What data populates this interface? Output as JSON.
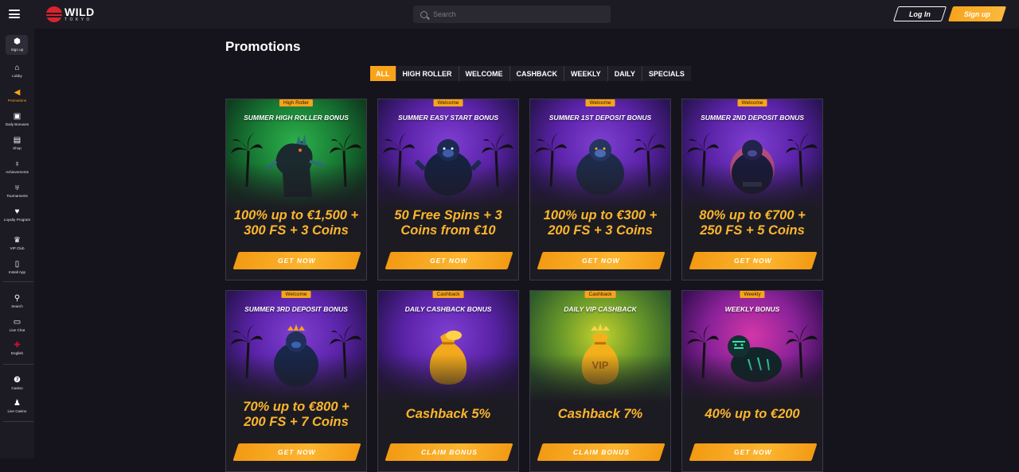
{
  "topbar": {
    "logo_main": "WILD",
    "logo_sub": "TOKYO",
    "search_placeholder": "Search",
    "login_label": "Log In",
    "signup_label": "Sign up"
  },
  "sidebar": {
    "items": [
      {
        "label": "Sign up",
        "icon": "plus-badge-icon"
      },
      {
        "label": "Lobby",
        "icon": "home-icon"
      },
      {
        "label": "Promotions",
        "icon": "megaphone-icon"
      },
      {
        "label": "Daily Bonuses",
        "icon": "gift-icon"
      },
      {
        "label": "Shop",
        "icon": "shop-icon"
      },
      {
        "label": "Achievements",
        "icon": "medal-icon"
      },
      {
        "label": "Tournaments",
        "icon": "trophy-icon"
      },
      {
        "label": "Loyalty Program",
        "icon": "heart-icon"
      },
      {
        "label": "VIP Club",
        "icon": "crown-icon"
      },
      {
        "label": "Install App",
        "icon": "phone-icon"
      },
      {
        "label": "Search",
        "icon": "search-icon"
      },
      {
        "label": "Live Chat",
        "icon": "chat-icon"
      },
      {
        "label": "English",
        "icon": "uk-flag-icon"
      },
      {
        "label": "Casino",
        "icon": "slot-icon"
      },
      {
        "label": "Live Casino",
        "icon": "dealer-icon"
      }
    ]
  },
  "page": {
    "title": "Promotions",
    "tabs": [
      "ALL",
      "HIGH ROLLER",
      "WELCOME",
      "CASHBACK",
      "WEEKLY",
      "DAILY",
      "SPECIALS"
    ],
    "active_tab": "ALL"
  },
  "promotions": [
    {
      "badge": "High Roller",
      "title": "SUMMER HIGH ROLLER BONUS",
      "offer_line1": "100% up to €1,500 +",
      "offer_line2": "300 FS + 3 Coins",
      "button": "GET NOW"
    },
    {
      "badge": "Welcome",
      "title": "SUMMER EASY START BONUS",
      "offer_line1": "50 Free Spins + 3",
      "offer_line2": "Coins from €10",
      "button": "GET NOW"
    },
    {
      "badge": "Welcome",
      "title": "SUMMER 1ST DEPOSIT BONUS",
      "offer_line1": "100% up to €300 +",
      "offer_line2": "200 FS + 3 Coins",
      "button": "GET NOW"
    },
    {
      "badge": "Welcome",
      "title": "SUMMER 2ND DEPOSIT BONUS",
      "offer_line1": "80% up to €700 +",
      "offer_line2": "250 FS + 5 Coins",
      "button": "GET NOW"
    },
    {
      "badge": "Welcome",
      "title": "SUMMER 3RD DEPOSIT BONUS",
      "offer_line1": "70% up to €800 +",
      "offer_line2": "200 FS + 7 Coins",
      "button": "GET NOW"
    },
    {
      "badge": "Cashback",
      "title": "DAILY CASHBACK BONUS",
      "offer_line1": "Cashback 5%",
      "offer_line2": "",
      "button": "CLAIM BONUS"
    },
    {
      "badge": "Cashback",
      "title": "DAILY VIP CASHBACK",
      "offer_line1": "Cashback 7%",
      "offer_line2": "",
      "button": "CLAIM BONUS"
    },
    {
      "badge": "Weekly",
      "title": "WEEKLY BONUS",
      "offer_line1": "40% up to €200",
      "offer_line2": "",
      "button": "GET NOW"
    }
  ],
  "colors": {
    "accent": "#f7a41b",
    "offer_text": "#fbb62d",
    "background": "#15131b",
    "panel": "#1c1a23"
  }
}
